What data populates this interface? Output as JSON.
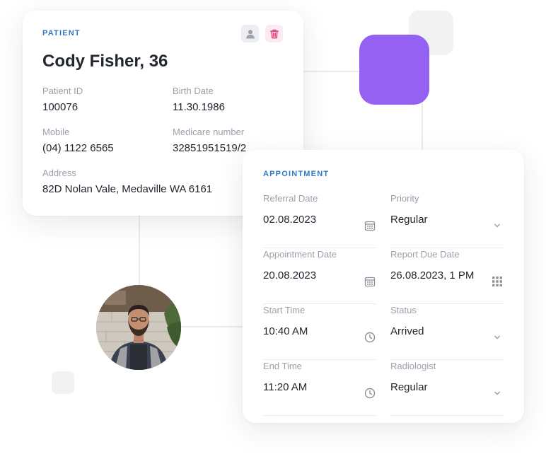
{
  "patient": {
    "section_label": "PATIENT",
    "name": "Cody Fisher, 36",
    "fields": {
      "patient_id": {
        "label": "Patient ID",
        "value": "100076"
      },
      "birth_date": {
        "label": "Birth Date",
        "value": "11.30.1986"
      },
      "mobile": {
        "label": "Mobile",
        "value": "(04) 1122 6565"
      },
      "medicare_number": {
        "label": "Medicare number",
        "value": "32851951519/2"
      },
      "address": {
        "label": "Address",
        "value": "82D Nolan Vale, Medaville WA 6161"
      }
    },
    "actions": {
      "profile_icon": "user-icon",
      "delete_icon": "trash-icon"
    }
  },
  "appointment": {
    "section_label": "APPOINTMENT",
    "fields": {
      "referral_date": {
        "label": "Referral Date",
        "value": "02.08.2023",
        "icon": "calendar-icon"
      },
      "priority": {
        "label": "Priority",
        "value": "Regular",
        "icon": "chevron-down-icon"
      },
      "appointment_date": {
        "label": "Appointment Date",
        "value": "20.08.2023",
        "icon": "calendar-icon"
      },
      "report_due_date": {
        "label": "Report Due Date",
        "value": "26.08.2023, 1 PM",
        "icon": "grid-icon"
      },
      "start_time": {
        "label": "Start Time",
        "value": "10:40 AM",
        "icon": "clock-icon"
      },
      "status": {
        "label": "Status",
        "value": "Arrived",
        "icon": "chevron-down-icon"
      },
      "end_time": {
        "label": "End Time",
        "value": "11:20 AM",
        "icon": "clock-icon"
      },
      "radiologist": {
        "label": "Radiologist",
        "value": "Regular",
        "icon": "chevron-down-icon"
      }
    }
  },
  "colors": {
    "accent_blue": "#2f79c5",
    "purple": "#9461f3",
    "delete_pink": "#e2447f",
    "label_gray": "#9ba1aa",
    "text_dark": "#22262e"
  }
}
